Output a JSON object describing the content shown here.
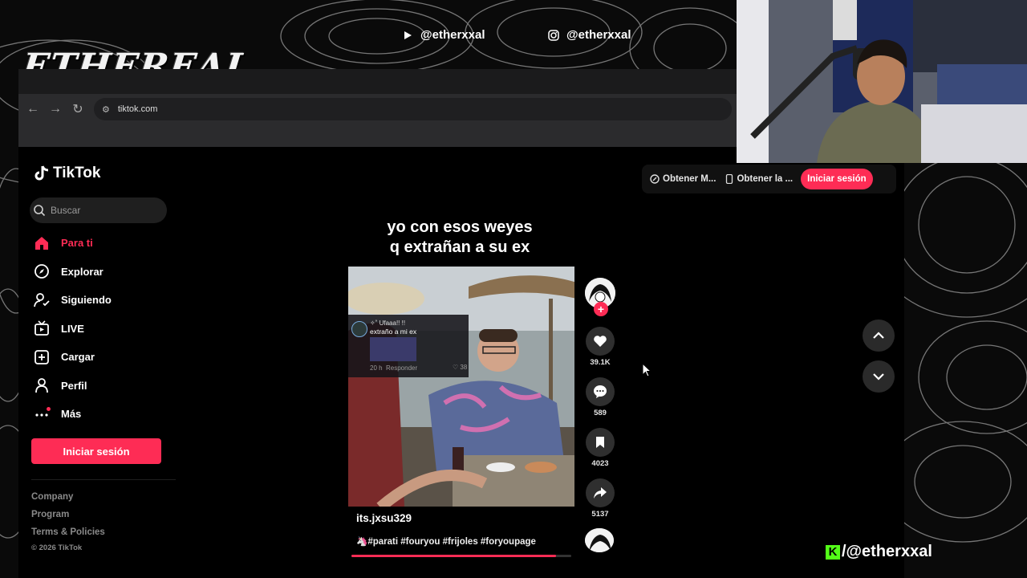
{
  "overlay": {
    "brand": "ETHEREAL",
    "youtube_handle": "@etherxxal",
    "instagram_handle": "@etherxxal",
    "kick_handle": "/@etherxxal"
  },
  "browser": {
    "url": "tiktok.com"
  },
  "tiktok": {
    "logo_text": "TikTok",
    "search_placeholder": "Buscar",
    "nav": [
      {
        "label": "Para ti",
        "icon": "home-icon"
      },
      {
        "label": "Explorar",
        "icon": "compass-icon"
      },
      {
        "label": "Siguiendo",
        "icon": "following-icon"
      },
      {
        "label": "LIVE",
        "icon": "live-icon"
      },
      {
        "label": "Cargar",
        "icon": "upload-icon"
      },
      {
        "label": "Perfil",
        "icon": "profile-icon"
      },
      {
        "label": "Más",
        "icon": "more-icon"
      }
    ],
    "login_button": "Iniciar sesión",
    "footer": {
      "company": "Company",
      "program": "Program",
      "terms": "Terms & Policies",
      "copyright": "© 2026 TikTok"
    },
    "top_buttons": {
      "get_coins": "Obtener M...",
      "get_app": "Obtener la ...",
      "login": "Iniciar sesión"
    },
    "video": {
      "caption_line1": "yo con esos weyes",
      "caption_line2": "q extrañan a su ex",
      "comment_user": "✧˚ Ufaaa!! !!",
      "comment_text": "extraño a mi ex",
      "comment_time": "20 h",
      "comment_reply": "Responder",
      "comment_likes": "38",
      "author": "its.jxsu329",
      "hashtags": "🦄#parati #fouryou #frijoles #foryoupage",
      "progress": 0.93
    },
    "actions": {
      "likes": "39.1K",
      "comments": "589",
      "saves": "4023",
      "shares": "5137"
    }
  },
  "colors": {
    "accent": "#fe2c55",
    "kick": "#53fc18"
  }
}
